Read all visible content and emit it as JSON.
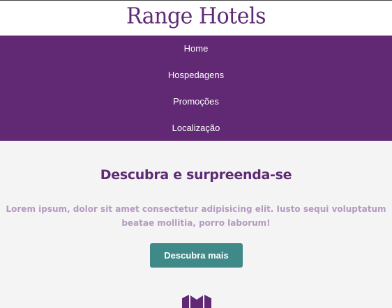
{
  "header": {
    "brand": "Range Hotels"
  },
  "nav": {
    "items": [
      {
        "label": "Home"
      },
      {
        "label": "Hospedagens"
      },
      {
        "label": "Promoções"
      },
      {
        "label": "Localização"
      }
    ]
  },
  "hero": {
    "title": "Descubra e surpreenda-se",
    "text": "Lorem ipsum, dolor sit amet consectetur adipisicing elit. Iusto sequi voluptatum beatae mollitia, porro laborum!",
    "cta_label": "Descubra mais"
  },
  "colors": {
    "brand_purple": "#612874",
    "cta_teal": "#3f8a88",
    "hero_text": "#b49ac0",
    "background": "#f4f4f4"
  },
  "icons": {
    "bottom_logo": "building-logo-icon"
  }
}
